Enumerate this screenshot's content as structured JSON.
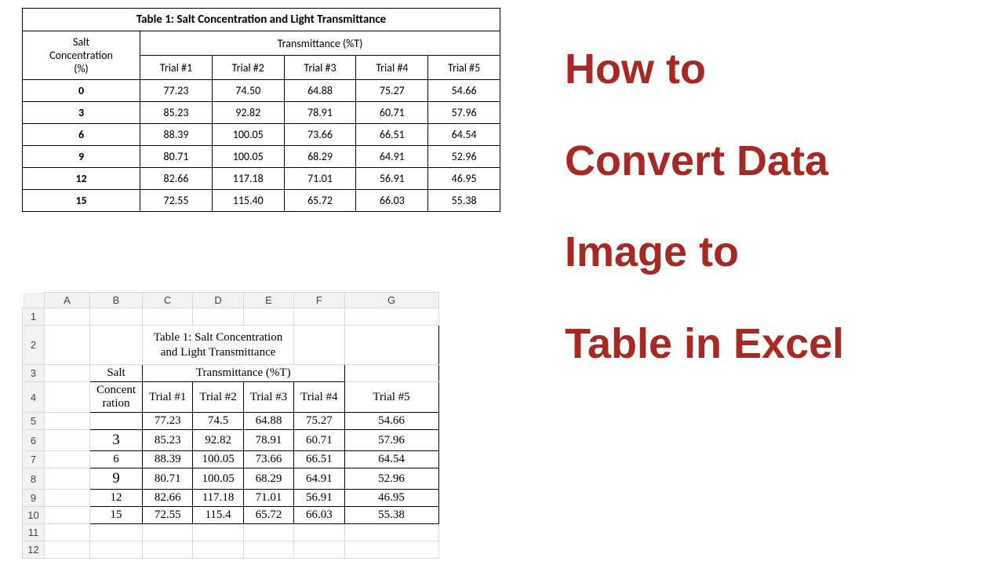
{
  "chart_data": {
    "type": "table",
    "title": "Table 1: Salt Concentration and Light Transmittance",
    "columns": [
      "Salt Concentration (%)",
      "Trial #1",
      "Trial #2",
      "Trial #3",
      "Trial #4",
      "Trial #5"
    ],
    "group_header": "Transmittance (%T)",
    "rows": [
      [
        0,
        77.23,
        74.5,
        64.88,
        75.27,
        54.66
      ],
      [
        3,
        85.23,
        92.82,
        78.91,
        60.71,
        57.96
      ],
      [
        6,
        88.39,
        100.05,
        73.66,
        66.51,
        64.54
      ],
      [
        9,
        80.71,
        100.05,
        68.29,
        64.91,
        52.96
      ],
      [
        12,
        82.66,
        117.18,
        71.01,
        56.91,
        46.95
      ],
      [
        15,
        72.55,
        115.4,
        65.72,
        66.03,
        55.38
      ]
    ]
  },
  "source_table": {
    "title": "Table 1: Salt Concentration and Light Transmittance",
    "col0_line1": "Salt",
    "col0_line2": "Concentration",
    "col0_line3": "(%)",
    "group_header": "Transmittance (%T)",
    "trial_labels": [
      "Trial #1",
      "Trial #2",
      "Trial #3",
      "Trial #4",
      "Trial #5"
    ],
    "rows": [
      {
        "c": "0",
        "v": [
          "77.23",
          "74.50",
          "64.88",
          "75.27",
          "54.66"
        ]
      },
      {
        "c": "3",
        "v": [
          "85.23",
          "92.82",
          "78.91",
          "60.71",
          "57.96"
        ]
      },
      {
        "c": "6",
        "v": [
          "88.39",
          "100.05",
          "73.66",
          "66.51",
          "64.54"
        ]
      },
      {
        "c": "9",
        "v": [
          "80.71",
          "100.05",
          "68.29",
          "64.91",
          "52.96"
        ]
      },
      {
        "c": "12",
        "v": [
          "82.66",
          "117.18",
          "71.01",
          "56.91",
          "46.95"
        ]
      },
      {
        "c": "15",
        "v": [
          "72.55",
          "115.40",
          "65.72",
          "66.03",
          "55.38"
        ]
      }
    ]
  },
  "excel": {
    "col_letters": [
      "A",
      "B",
      "C",
      "D",
      "E",
      "F",
      "G"
    ],
    "row_numbers": [
      "1",
      "2",
      "3",
      "4",
      "5",
      "6",
      "7",
      "8",
      "9",
      "10",
      "11",
      "12"
    ],
    "title_line1": "Table 1: Salt Concentration",
    "title_line2": "and Light Transmittance",
    "col0_line1": "Salt",
    "col0_line2": "Concent",
    "col0_line3": "ration",
    "group_header": "Transmittance (%T)",
    "trial_labels": [
      "Trial #1",
      "Trial #2",
      "Trial #3",
      "Trial #4",
      "Trial #5"
    ],
    "rows": [
      {
        "c": "",
        "v": [
          "77.23",
          "74.5",
          "64.88",
          "75.27",
          "54.66"
        ]
      },
      {
        "c": "3",
        "v": [
          "85.23",
          "92.82",
          "78.91",
          "60.71",
          "57.96"
        ]
      },
      {
        "c": "6",
        "v": [
          "88.39",
          "100.05",
          "73.66",
          "66.51",
          "64.54"
        ]
      },
      {
        "c": "9",
        "v": [
          "80.71",
          "100.05",
          "68.29",
          "64.91",
          "52.96"
        ]
      },
      {
        "c": "12",
        "v": [
          "82.66",
          "117.18",
          "71.01",
          "56.91",
          "46.95"
        ]
      },
      {
        "c": "15",
        "v": [
          "72.55",
          "115.4",
          "65.72",
          "66.03",
          "55.38"
        ]
      }
    ]
  },
  "headline": {
    "l1": "How to",
    "l2": "Convert Data",
    "l3": "Image to",
    "l4": "Table in Excel"
  }
}
